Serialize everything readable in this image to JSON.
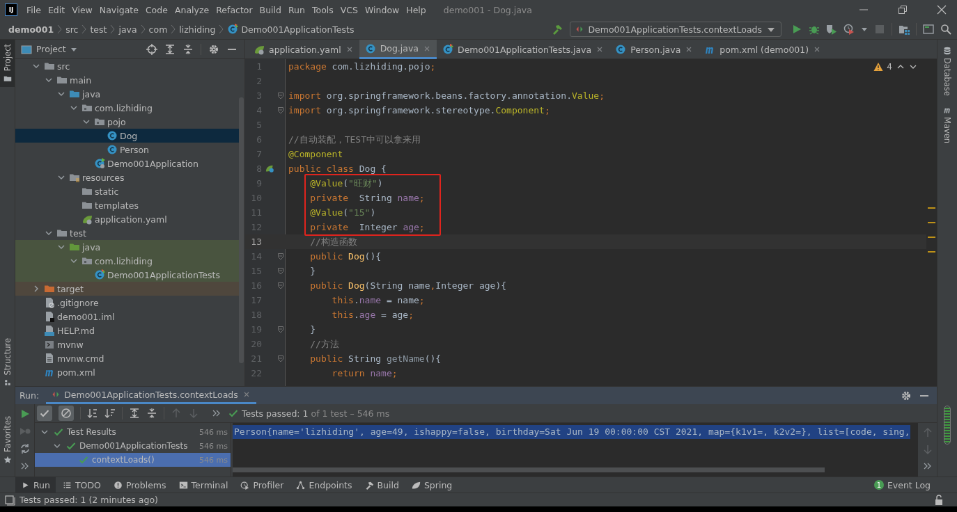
{
  "title_bar": {
    "logo": "IJ",
    "menus": [
      "File",
      "Edit",
      "View",
      "Navigate",
      "Code",
      "Analyze",
      "Refactor",
      "Build",
      "Run",
      "Tools",
      "VCS",
      "Window",
      "Help"
    ],
    "title": "demo001 - Dog.java"
  },
  "nav_bar": {
    "breadcrumbs": [
      {
        "label": "demo001",
        "kind": "project"
      },
      {
        "label": "src",
        "kind": "folder"
      },
      {
        "label": "test",
        "kind": "folder"
      },
      {
        "label": "java",
        "kind": "folder"
      },
      {
        "label": "com",
        "kind": "folder"
      },
      {
        "label": "lizhiding",
        "kind": "folder"
      },
      {
        "label": "Demo001ApplicationTests",
        "kind": "test-class"
      }
    ],
    "run_config": "Demo001ApplicationTests.contextLoads"
  },
  "left_stripe": {
    "top": [
      {
        "label": "Project",
        "kind": "project",
        "selected": true
      }
    ],
    "bottom": [
      {
        "label": "Structure",
        "kind": "structure",
        "selected": false
      },
      {
        "label": "Favorites",
        "kind": "favorites",
        "selected": false
      }
    ]
  },
  "project_panel": {
    "title": "Project",
    "tree": [
      {
        "label": "src",
        "kind": "folder",
        "expanded": true,
        "selected": false,
        "children": [
          {
            "label": "main",
            "kind": "folder",
            "expanded": true,
            "selected": false,
            "children": [
              {
                "label": "java",
                "kind": "source-root",
                "expanded": true,
                "selected": false,
                "children": [
                  {
                    "label": "com.lizhiding",
                    "kind": "package",
                    "expanded": true,
                    "selected": false,
                    "children": [
                      {
                        "label": "pojo",
                        "kind": "package",
                        "expanded": true,
                        "selected": false,
                        "children": [
                          {
                            "label": "Dog",
                            "kind": "class",
                            "selected": true
                          },
                          {
                            "label": "Person",
                            "kind": "class",
                            "selected": false
                          }
                        ]
                      },
                      {
                        "label": "Demo001Application",
                        "kind": "spring-class",
                        "selected": false
                      }
                    ]
                  }
                ]
              },
              {
                "label": "resources",
                "kind": "resource-root",
                "expanded": true,
                "selected": false,
                "children": [
                  {
                    "label": "static",
                    "kind": "folder",
                    "selected": false
                  },
                  {
                    "label": "templates",
                    "kind": "folder",
                    "selected": false
                  },
                  {
                    "label": "application.yaml",
                    "kind": "yaml",
                    "selected": false
                  }
                ]
              }
            ]
          },
          {
            "label": "test",
            "kind": "folder",
            "expanded": true,
            "selected": false,
            "children": [
              {
                "label": "java",
                "kind": "test-root",
                "expanded": true,
                "selected": false,
                "children": [
                  {
                    "label": "com.lizhiding",
                    "kind": "package",
                    "expanded": true,
                    "selected": false,
                    "children": [
                      {
                        "label": "Demo001ApplicationTests",
                        "kind": "test-class",
                        "selected": false
                      }
                    ]
                  }
                ]
              }
            ]
          }
        ]
      },
      {
        "label": "target",
        "kind": "excluded-folder",
        "expanded": false,
        "selected": false
      },
      {
        "label": ".gitignore",
        "kind": "ignore-file",
        "selected": false
      },
      {
        "label": "demo001.iml",
        "kind": "module-file",
        "selected": false
      },
      {
        "label": "HELP.md",
        "kind": "markdown",
        "selected": false
      },
      {
        "label": "mvnw",
        "kind": "shell",
        "selected": false
      },
      {
        "label": "mvnw.cmd",
        "kind": "text-file",
        "selected": false
      },
      {
        "label": "pom.xml",
        "kind": "maven",
        "selected": false
      }
    ]
  },
  "editor": {
    "tabs": [
      {
        "label": "application.yaml",
        "kind": "yaml",
        "selected": false
      },
      {
        "label": "Dog.java",
        "kind": "class",
        "selected": true
      },
      {
        "label": "Demo001ApplicationTests.java",
        "kind": "test-class",
        "selected": false
      },
      {
        "label": "Person.java",
        "kind": "class",
        "selected": false
      },
      {
        "label": "pom.xml (demo001)",
        "kind": "maven",
        "selected": false
      }
    ],
    "warning_count": "4",
    "lines": [
      {
        "number": "1",
        "fold": false,
        "boxed": false,
        "current": false,
        "tokens": [
          {
            "text": "package",
            "kind": "keyword"
          },
          {
            "text": " com.lizhiding.pojo",
            "kind": "plain"
          },
          {
            "text": ";",
            "kind": "keyword"
          }
        ]
      },
      {
        "number": "2",
        "fold": false,
        "boxed": false,
        "current": false
      },
      {
        "number": "3",
        "fold": true,
        "boxed": false,
        "current": false,
        "tokens": [
          {
            "text": "import",
            "kind": "keyword"
          },
          {
            "text": " org.springframework.beans.factory.annotation.",
            "kind": "plain"
          },
          {
            "text": "Value",
            "kind": "annotation"
          },
          {
            "text": ";",
            "kind": "keyword"
          }
        ]
      },
      {
        "number": "4",
        "fold": true,
        "boxed": false,
        "current": false,
        "tokens": [
          {
            "text": "import",
            "kind": "keyword"
          },
          {
            "text": " org.springframework.stereotype.",
            "kind": "plain"
          },
          {
            "text": "Component",
            "kind": "annotation"
          },
          {
            "text": ";",
            "kind": "keyword"
          }
        ]
      },
      {
        "number": "5",
        "fold": false,
        "boxed": false,
        "current": false
      },
      {
        "number": "6",
        "fold": false,
        "boxed": false,
        "current": false,
        "tokens": [
          {
            "text": "//自动装配，TEST中可以拿来用",
            "kind": "comment"
          }
        ]
      },
      {
        "number": "7",
        "fold": false,
        "boxed": false,
        "current": false,
        "tokens": [
          {
            "text": "@Component",
            "kind": "annotation"
          }
        ]
      },
      {
        "number": "8",
        "kind": "bean",
        "fold": false,
        "boxed": false,
        "current": false,
        "tokens": [
          {
            "text": "public class",
            "kind": "keyword"
          },
          {
            "text": " Dog {",
            "kind": "plain"
          }
        ]
      },
      {
        "number": "9",
        "fold": false,
        "boxed": true,
        "current": false,
        "tokens": [
          {
            "text": "    @Value",
            "kind": "annotation"
          },
          {
            "text": "(",
            "kind": "plain"
          },
          {
            "text": "\"旺财\"",
            "kind": "string"
          },
          {
            "text": ")",
            "kind": "plain"
          }
        ]
      },
      {
        "number": "10",
        "fold": false,
        "boxed": true,
        "current": false,
        "tokens": [
          {
            "text": "    private",
            "kind": "keyword"
          },
          {
            "text": "  String ",
            "kind": "plain"
          },
          {
            "text": "name",
            "kind": "field"
          },
          {
            "text": ";",
            "kind": "keyword"
          }
        ]
      },
      {
        "number": "11",
        "fold": false,
        "boxed": true,
        "current": false,
        "tokens": [
          {
            "text": "    @Value",
            "kind": "annotation"
          },
          {
            "text": "(",
            "kind": "plain"
          },
          {
            "text": "\"15\"",
            "kind": "string"
          },
          {
            "text": ")",
            "kind": "plain"
          }
        ]
      },
      {
        "number": "12",
        "fold": false,
        "boxed": true,
        "current": false,
        "tokens": [
          {
            "text": "    private",
            "kind": "keyword"
          },
          {
            "text": "  Integer ",
            "kind": "plain"
          },
          {
            "text": "age",
            "kind": "field"
          },
          {
            "text": ";",
            "kind": "keyword"
          }
        ]
      },
      {
        "number": "13",
        "fold": false,
        "boxed": false,
        "current": true,
        "tokens": [
          {
            "text": "    //构造函数",
            "kind": "comment"
          }
        ]
      },
      {
        "number": "14",
        "fold": true,
        "boxed": false,
        "current": false,
        "tokens": [
          {
            "text": "    public ",
            "kind": "keyword"
          },
          {
            "text": "Dog",
            "kind": "method"
          },
          {
            "text": "(){",
            "kind": "plain"
          }
        ]
      },
      {
        "number": "15",
        "fold": true,
        "boxed": false,
        "current": false,
        "tokens": [
          {
            "text": "    }",
            "kind": "plain"
          }
        ]
      },
      {
        "number": "16",
        "fold": true,
        "boxed": false,
        "current": false,
        "tokens": [
          {
            "text": "    public ",
            "kind": "keyword"
          },
          {
            "text": "Dog",
            "kind": "method"
          },
          {
            "text": "(String name",
            "kind": "plain"
          },
          {
            "text": ",",
            "kind": "keyword"
          },
          {
            "text": "Integer age){",
            "kind": "plain"
          }
        ]
      },
      {
        "number": "17",
        "fold": false,
        "boxed": false,
        "current": false,
        "tokens": [
          {
            "text": "        this",
            "kind": "keyword"
          },
          {
            "text": ".",
            "kind": "plain"
          },
          {
            "text": "name",
            "kind": "field"
          },
          {
            "text": " = name",
            "kind": "plain"
          },
          {
            "text": ";",
            "kind": "keyword"
          }
        ]
      },
      {
        "number": "18",
        "fold": false,
        "boxed": false,
        "current": false,
        "tokens": [
          {
            "text": "        this",
            "kind": "keyword"
          },
          {
            "text": ".",
            "kind": "plain"
          },
          {
            "text": "age",
            "kind": "field"
          },
          {
            "text": " = age",
            "kind": "plain"
          },
          {
            "text": ";",
            "kind": "keyword"
          }
        ]
      },
      {
        "number": "19",
        "fold": true,
        "boxed": false,
        "current": false,
        "tokens": [
          {
            "text": "    }",
            "kind": "plain"
          }
        ]
      },
      {
        "number": "20",
        "fold": false,
        "boxed": false,
        "current": false,
        "tokens": [
          {
            "text": "    //方法",
            "kind": "comment"
          }
        ]
      },
      {
        "number": "21",
        "fold": true,
        "boxed": false,
        "current": false,
        "tokens": [
          {
            "text": "    public ",
            "kind": "keyword"
          },
          {
            "text": "String ",
            "kind": "plain"
          },
          {
            "text": "getName",
            "kind": "unused"
          },
          {
            "text": "(){",
            "kind": "plain"
          }
        ]
      },
      {
        "number": "22",
        "fold": false,
        "boxed": false,
        "current": false,
        "tokens": [
          {
            "text": "        return ",
            "kind": "keyword"
          },
          {
            "text": "name",
            "kind": "field"
          },
          {
            "text": ";",
            "kind": "keyword"
          }
        ]
      }
    ]
  },
  "right_stripe": [
    {
      "label": "Database",
      "kind": "database"
    },
    {
      "label": "Maven",
      "kind": "maven"
    }
  ],
  "run_panel": {
    "label": "Run:",
    "tab": "Demo001ApplicationTests.contextLoads",
    "toggles": [
      {
        "kind": "show-passed",
        "on": true
      },
      {
        "kind": "show-ignored",
        "on": true
      }
    ],
    "status": "Tests passed: 1",
    "status_detail": "of 1 test – 546 ms",
    "tests": [
      {
        "label": "Test Results",
        "time": "546 ms",
        "kind": "passed",
        "expanded": true,
        "selected": false,
        "children": [
          {
            "label": "Demo001ApplicationTests",
            "time": "546 ms",
            "kind": "passed",
            "expanded": true,
            "selected": false,
            "children": [
              {
                "label": "contextLoads()",
                "time": "546 ms",
                "kind": "passed",
                "selected": true
              }
            ]
          }
        ]
      }
    ],
    "console": [
      "Person{name='lizhiding', age=49, ishappy=false, birthday=Sat Jun 19 00:00:00 CST 2021, map={k1v1=, k2v2=}, list=[code, sing,"
    ]
  },
  "tool_windows": [
    {
      "label": "Run",
      "kind": "run",
      "selected": true
    },
    {
      "label": "TODO",
      "kind": "todo",
      "selected": false
    },
    {
      "label": "Problems",
      "kind": "problems",
      "selected": false
    },
    {
      "label": "Terminal",
      "kind": "terminal",
      "selected": false
    },
    {
      "label": "Profiler",
      "kind": "profiler",
      "selected": false
    },
    {
      "label": "Endpoints",
      "kind": "endpoints",
      "selected": false
    },
    {
      "label": "Build",
      "kind": "build",
      "selected": false
    },
    {
      "label": "Spring",
      "kind": "spring",
      "selected": false
    }
  ],
  "event_log": {
    "label": "Event Log",
    "count": "1"
  },
  "status_bar": {
    "message": "Tests passed: 1 (2 minutes ago)"
  }
}
